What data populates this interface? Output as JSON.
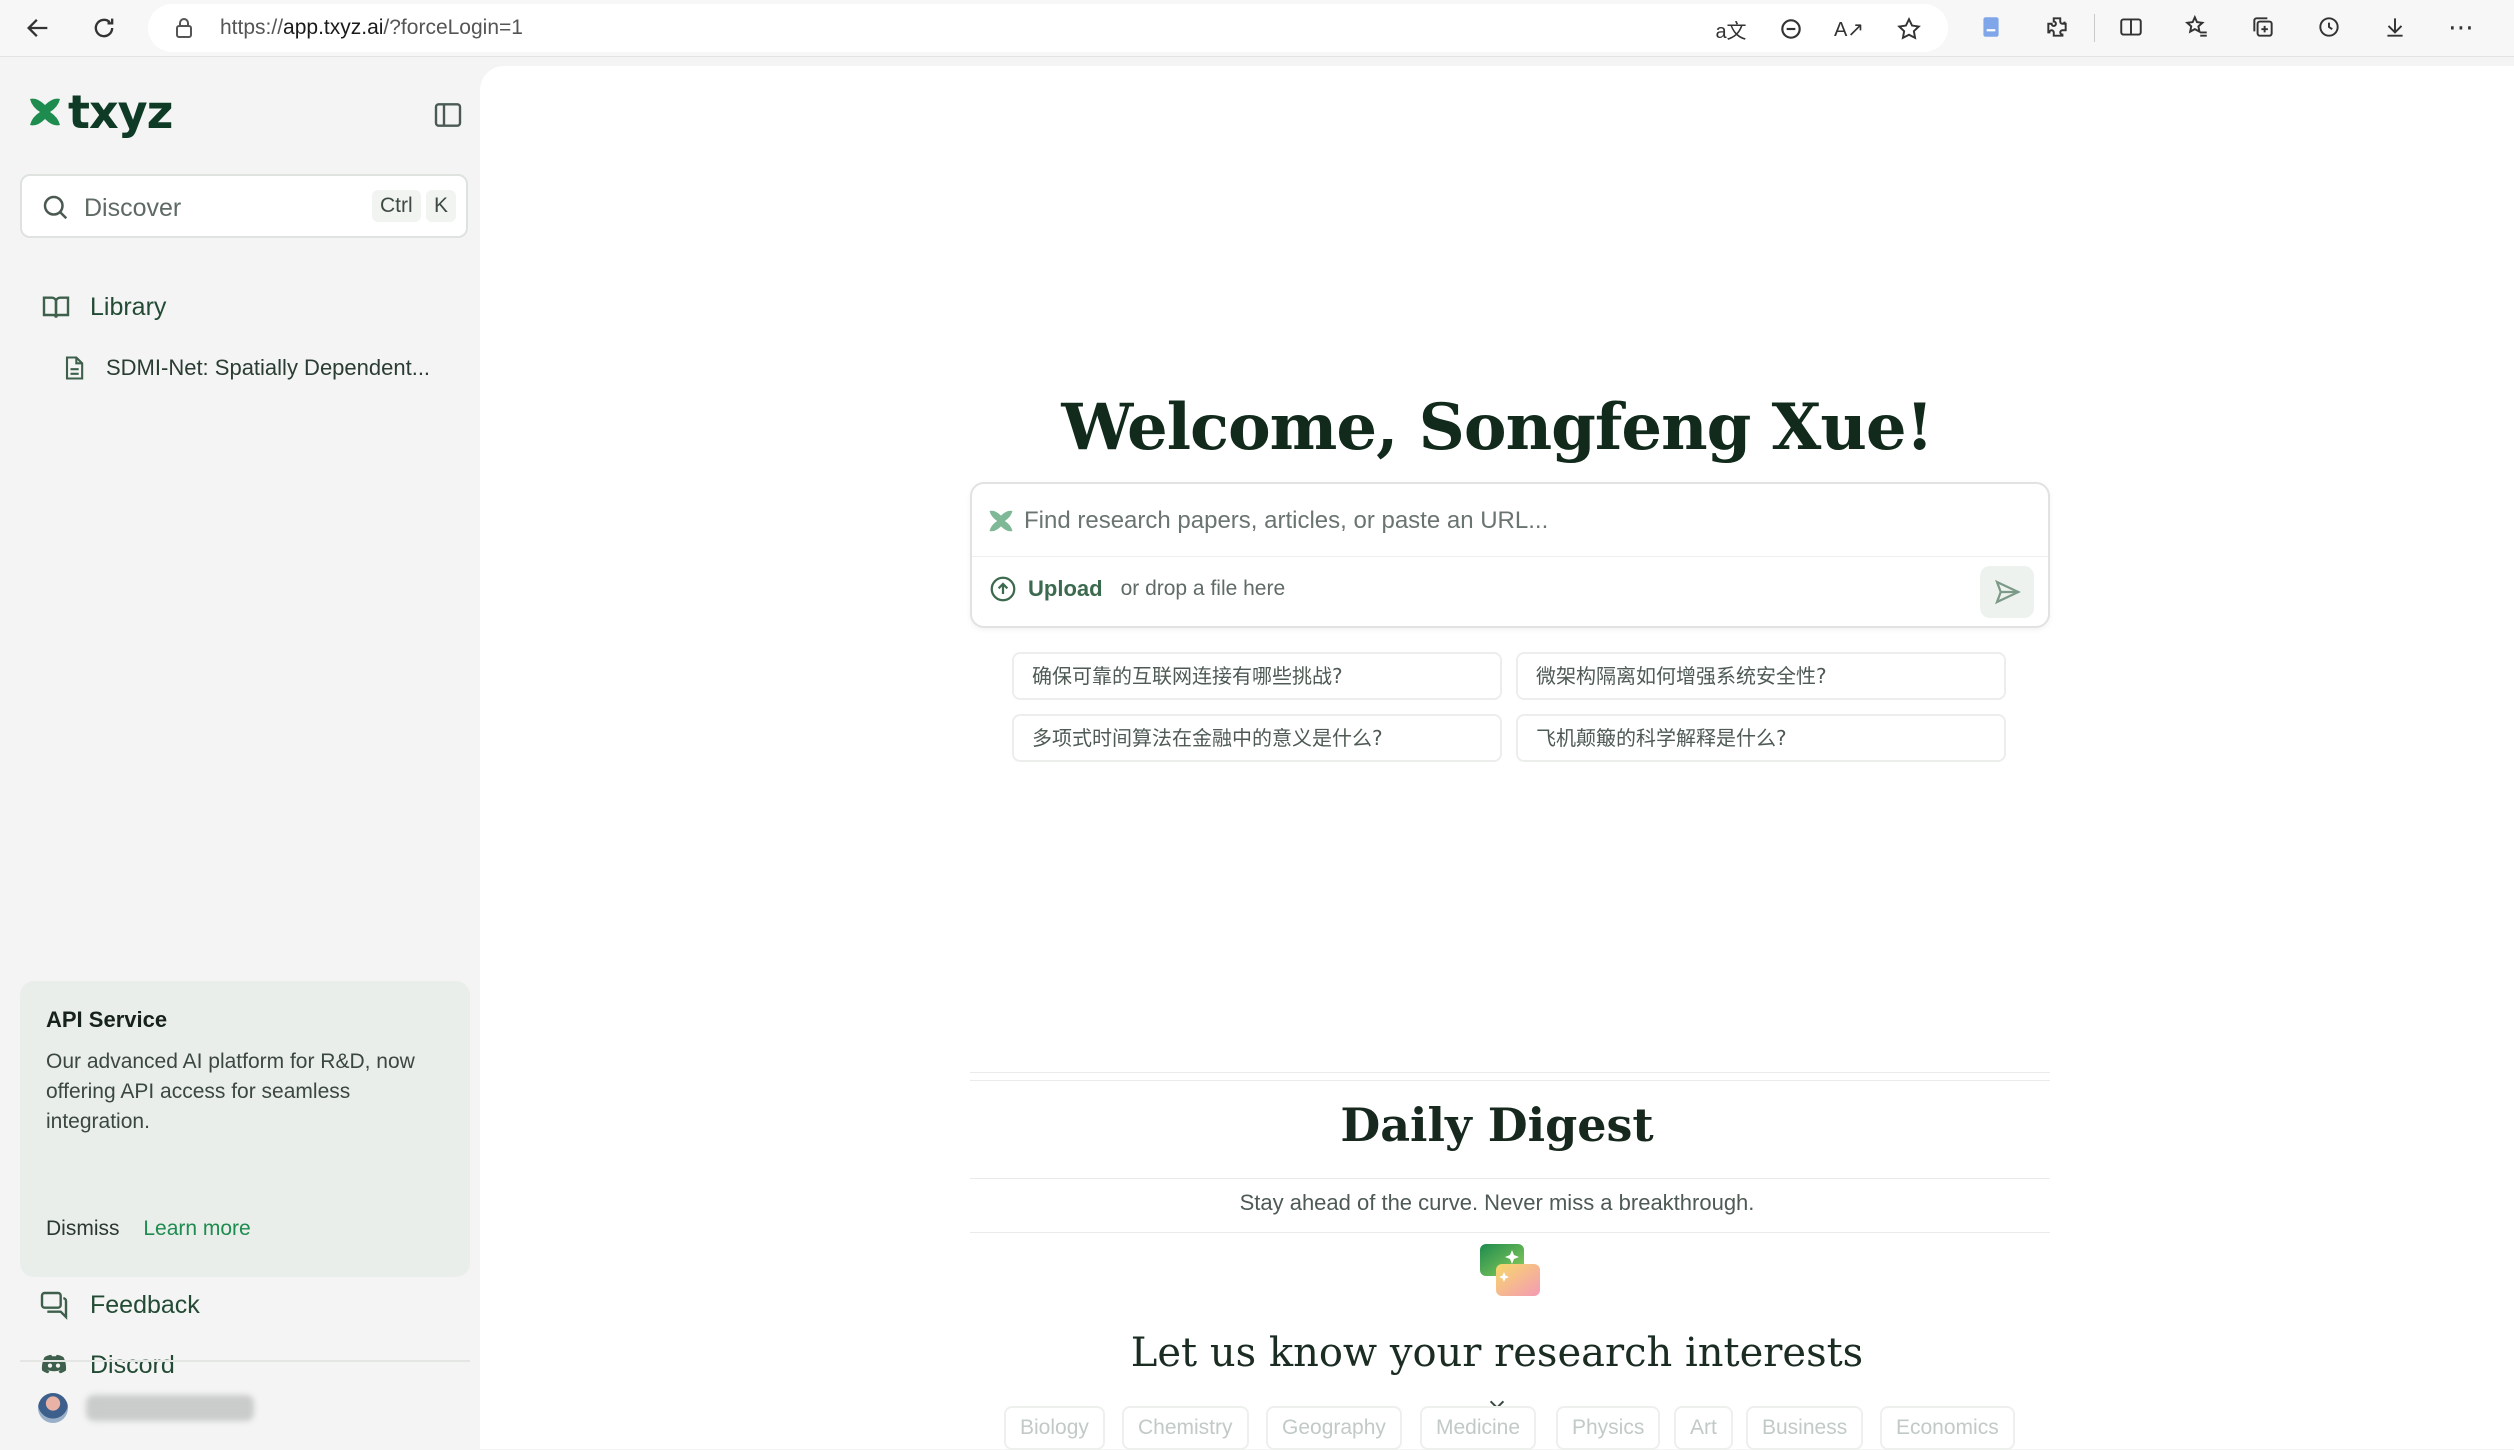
{
  "browser": {
    "url_prefix": "https://",
    "url_host": "app.txyz.ai",
    "url_path": "/?forceLogin=1",
    "toolbar_icons": [
      "back-icon",
      "reload-icon",
      "lock-icon",
      "translate-icon",
      "bing-icon",
      "read-aloud-icon",
      "favorite-star-icon",
      "doc-icon",
      "extensions-icon",
      "split-screen-icon",
      "favorites-icon",
      "collections-icon",
      "history-icon",
      "downloads-icon",
      "more-icon"
    ]
  },
  "sidebar": {
    "logo_text": "txyz",
    "search": {
      "label": "Discover",
      "key1": "Ctrl",
      "key2": "K"
    },
    "library_label": "Library",
    "library_items": [
      "SDMI-Net: Spatially Dependent..."
    ],
    "api_card": {
      "title": "API Service",
      "description": "Our advanced AI platform for R&D, now offering API access for seamless integration.",
      "dismiss": "Dismiss",
      "learn_more": "Learn more"
    },
    "feedback_label": "Feedback",
    "discord_label": "Discord"
  },
  "main": {
    "welcome": "Welcome, Songfeng Xue!",
    "query": {
      "placeholder": "Find research papers, articles, or paste an URL...",
      "upload_label": "Upload",
      "upload_hint": "or drop a file here"
    },
    "suggestions": [
      "确保可靠的互联网连接有哪些挑战?",
      "微架构隔离如何增强系统安全性?",
      "多项式时间算法在金融中的意义是什么?",
      "飞机颠簸的科学解释是什么?"
    ],
    "digest": {
      "title": "Daily Digest",
      "subtitle": "Stay ahead of the curve. Never miss a breakthrough.",
      "interests_title": "Let us know your research interests",
      "topics": [
        "Biology",
        "Chemistry",
        "Geography",
        "Medicine",
        "Physics",
        "Art",
        "Business",
        "Economics"
      ]
    }
  },
  "colors": {
    "brand_green": "#1e8b4f",
    "dark_green": "#0e3a26",
    "sidebar_bg": "#f3f4f3"
  }
}
